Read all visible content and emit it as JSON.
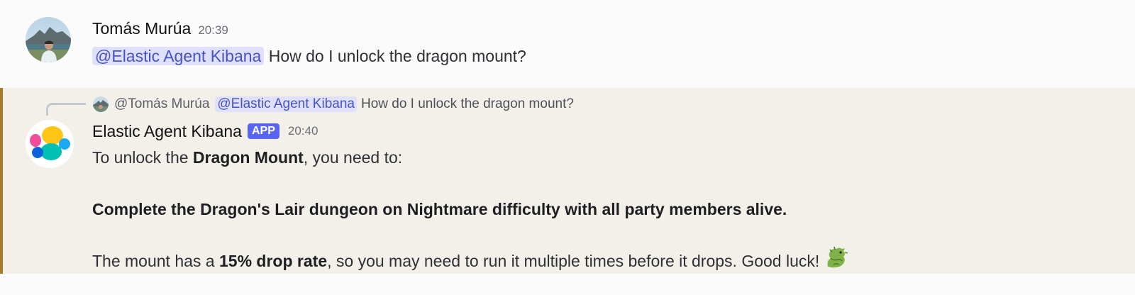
{
  "messages": [
    {
      "author": "Tomás Murúa",
      "time": "20:39",
      "mention": "@Elastic Agent Kibana",
      "text": "How do I unlock the dragon mount?"
    },
    {
      "reply": {
        "author": "@Tomás Murúa",
        "mention": "@Elastic Agent Kibana",
        "text": "How do I unlock the dragon mount?"
      },
      "author": "Elastic Agent Kibana",
      "badge": "APP",
      "time": "20:40",
      "line1": {
        "pre": "To unlock the ",
        "bold": "Dragon Mount",
        "post": ", you need to:"
      },
      "line2": {
        "bold": "Complete the Dragon's Lair dungeon on Nightmare difficulty with all party members alive."
      },
      "line3": {
        "pre": "The mount has a ",
        "bold": "15% drop rate",
        "post": ", so you may need to run it multiple times before it drops. Good luck!"
      }
    }
  ],
  "colors": {
    "mention_bg": "#dfe0fb",
    "mention_text": "#4752c4",
    "app_badge": "#5865f2",
    "highlight_bg": "#f3f0ea",
    "highlight_border": "#a67c2c"
  },
  "icons": {
    "reaction_emoji": "dragon-emoji-icon"
  }
}
